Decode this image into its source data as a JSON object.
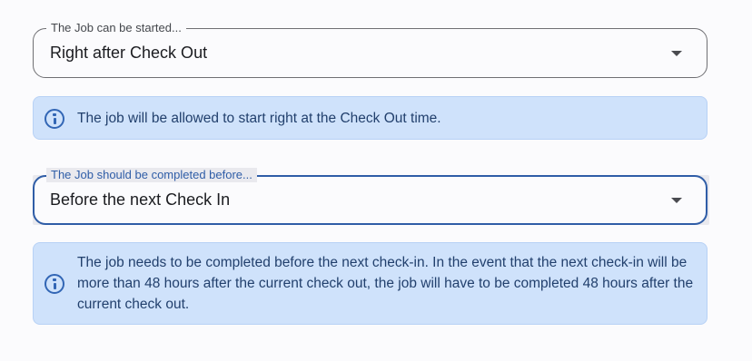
{
  "start_field": {
    "label": "The Job can be started...",
    "value": "Right after Check Out"
  },
  "start_info": {
    "text": "The job will be allowed to start right at the Check Out time."
  },
  "complete_field": {
    "label": "The Job should be completed before...",
    "value": "Before the next Check In"
  },
  "complete_info": {
    "text": "The job needs to be completed before the next check-in. In the event that the next check-in will be more than 48 hours after the current check out, the job will have to be completed 48 hours after the current check out."
  },
  "icons": {
    "info": "info-icon",
    "dropdown": "chevron-down-icon"
  },
  "colors": {
    "focus_blue": "#2f5da7",
    "info_bg": "#cfe2fb",
    "info_text": "#22406d"
  }
}
